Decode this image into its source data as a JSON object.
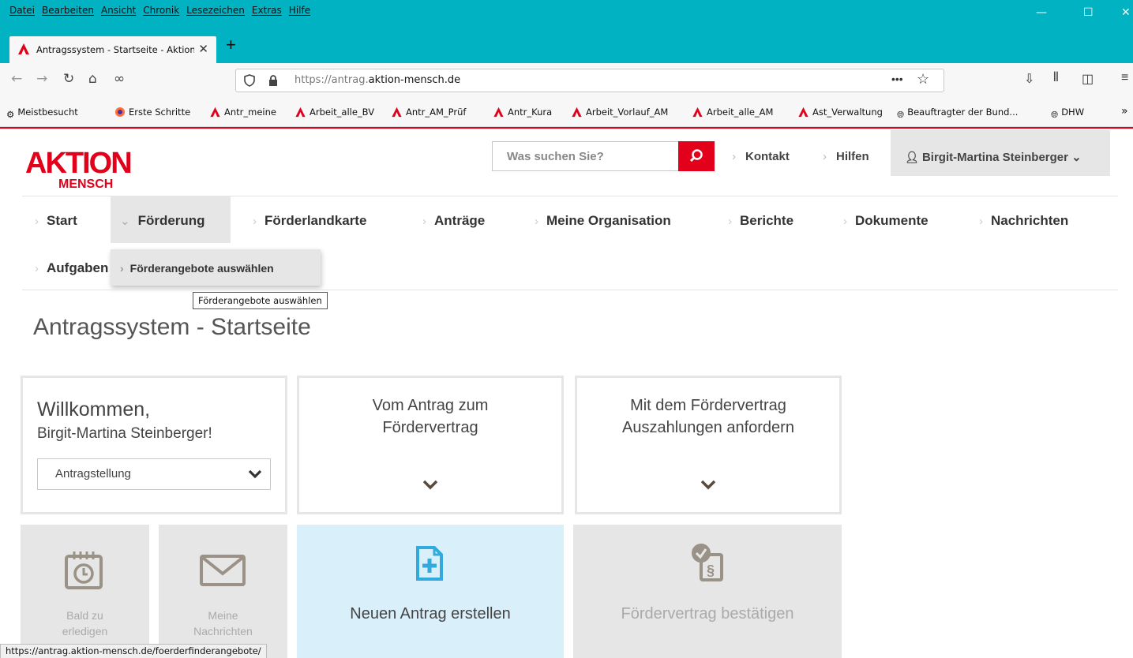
{
  "browser": {
    "menu": [
      "Datei",
      "Bearbeiten",
      "Ansicht",
      "Chronik",
      "Lesezeichen",
      "Extras",
      "Hilfe"
    ],
    "tab_title": "Antragssystem - Startseite - Aktion Mensch",
    "url_prefix": "https://antrag.",
    "url_domain": "aktion-mensch.de",
    "url_more": "•••",
    "bookmarks": [
      "Meistbesucht",
      "Erste Schritte",
      "Antr_meine",
      "Arbeit_alle_BV",
      "Antr_AM_Prüf",
      "Antr_Kura",
      "Arbeit_Vorlauf_AM",
      "Arbeit_alle_AM",
      "Ast_Verwaltung",
      "Beauftragter der Bund...",
      "DHW"
    ],
    "bookmarks_overflow": "»",
    "status_url": "https://antrag.aktion-mensch.de/foerderfinderangebote/"
  },
  "header": {
    "logo_top": "AKTION",
    "logo_bottom": "MENSCH",
    "search_placeholder": "Was suchen Sie?",
    "links": [
      "Kontakt",
      "Hilfen"
    ],
    "user_name": "Birgit-Martina Steinberger"
  },
  "nav": {
    "items": [
      "Start",
      "Förderung",
      "Förderlandkarte",
      "Anträge",
      "Meine Organisation",
      "Berichte",
      "Dokumente",
      "Nachrichten",
      "Aufgaben"
    ],
    "dropdown_item": "Förderangebote auswählen",
    "tooltip": "Förderangebote auswählen"
  },
  "page": {
    "title": "Antragssystem - Startseite",
    "welcome_line1": "Willkommen,",
    "welcome_line2": "Birgit-Martina Steinberger!",
    "select_value": "Antragstellung",
    "card2_line1": "Vom Antrag zum",
    "card2_line2": "Fördervertrag",
    "card3_line1": "Mit dem Fördervertrag",
    "card3_line2": "Auszahlungen anfordern",
    "tile1_line1": "Bald zu",
    "tile1_line2": "erledigen",
    "tile2_line1": "Meine",
    "tile2_line2": "Nachrichten",
    "tile3": "Neuen Antrag erstellen",
    "tile4": "Fördervertrag bestätigen"
  },
  "colors": {
    "brand_red": "#e2001a",
    "chrome_teal": "#00b2c2",
    "tile_active": "#d9f0fa",
    "tile_active_icon": "#33aadd"
  }
}
